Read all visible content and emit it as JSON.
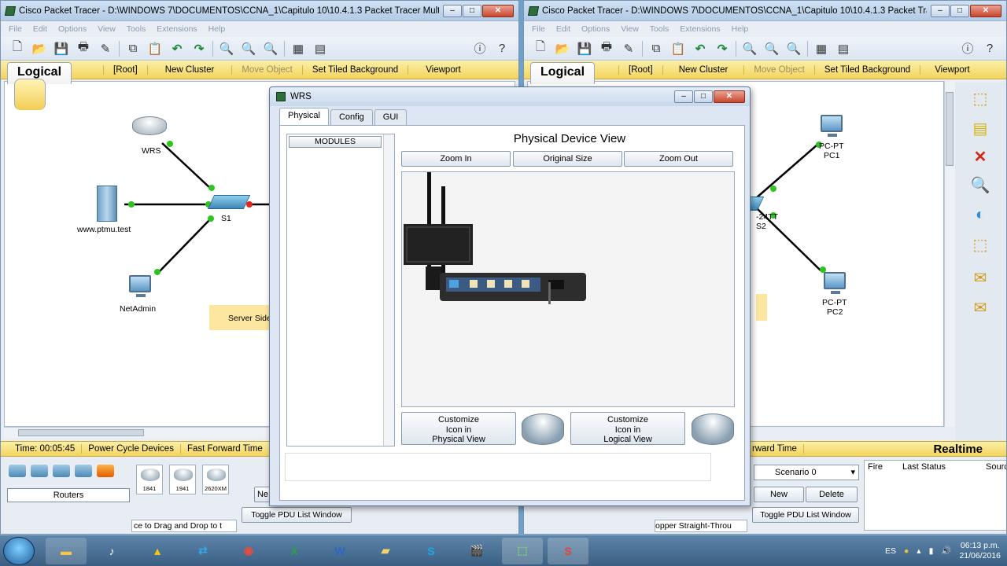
{
  "left_window": {
    "title": "Cisco Packet Tracer - D:\\WINDOWS 7\\DOCUMENTOS\\CCNA_1\\Capitulo 10\\10.4.1.3 Packet Tracer Multiu...",
    "menu": [
      "File",
      "Edit",
      "Options",
      "View",
      "Tools",
      "Extensions",
      "Help"
    ],
    "logical_tab": "Logical",
    "logical_items": [
      "[Root]",
      "New Cluster",
      "Move Object",
      "Set Tiled Background",
      "Viewport"
    ],
    "nodes": {
      "wrs": "WRS",
      "s1": "S1",
      "server": "www.ptmu.test",
      "netadmin": "NetAdmin",
      "note": "Server Side"
    },
    "bottom_bar": {
      "time": "Time: 00:05:45",
      "power": "Power Cycle Devices",
      "fast": "Fast Forward Time"
    },
    "category": "Routers",
    "models": [
      "1841",
      "1941",
      "2620XM"
    ],
    "drag_hint": "ce to Drag and Drop to t",
    "toggle_pdu": "Toggle PDU List Window",
    "new_partial": "Ne"
  },
  "right_window": {
    "title": "Cisco Packet Tracer - D:\\WINDOWS 7\\DOCUMENTOS\\CCNA_1\\Capitulo 10\\10.4.1.3 Packet Tracer...",
    "menu": [
      "File",
      "Edit",
      "Options",
      "View",
      "Tools",
      "Extensions",
      "Help"
    ],
    "logical_tab": "Logical",
    "logical_items": [
      "[Root]",
      "New Cluster",
      "Move Object",
      "Set Tiled Background",
      "Viewport"
    ],
    "nodes": {
      "pc1_type": "PC-PT",
      "pc1_name": "PC1",
      "pc2_type": "PC-PT",
      "pc2_name": "PC2",
      "s2_partial": "-24TT",
      "s2_label": "S2"
    },
    "realtime": "Realtime",
    "fast_partial": "rward Time",
    "scenario": "Scenario 0",
    "new_btn": "New",
    "delete_btn": "Delete",
    "toggle_pdu": "Toggle PDU List Window",
    "pdu_cols": [
      "Fire",
      "Last Status",
      "Sourc"
    ],
    "cable_hint": "opper Straight-Throu"
  },
  "dialog": {
    "title": "WRS",
    "tabs": [
      "Physical",
      "Config",
      "GUI"
    ],
    "modules_header": "MODULES",
    "view_title": "Physical Device View",
    "zoom_in": "Zoom In",
    "original_size": "Original Size",
    "zoom_out": "Zoom Out",
    "customize_physical": [
      "Customize",
      "Icon in",
      "Physical View"
    ],
    "customize_logical": [
      "Customize",
      "Icon in",
      "Logical View"
    ]
  },
  "taskbar": {
    "lang": "ES",
    "time": "06:13 p.m.",
    "date": "21/06/2016"
  }
}
